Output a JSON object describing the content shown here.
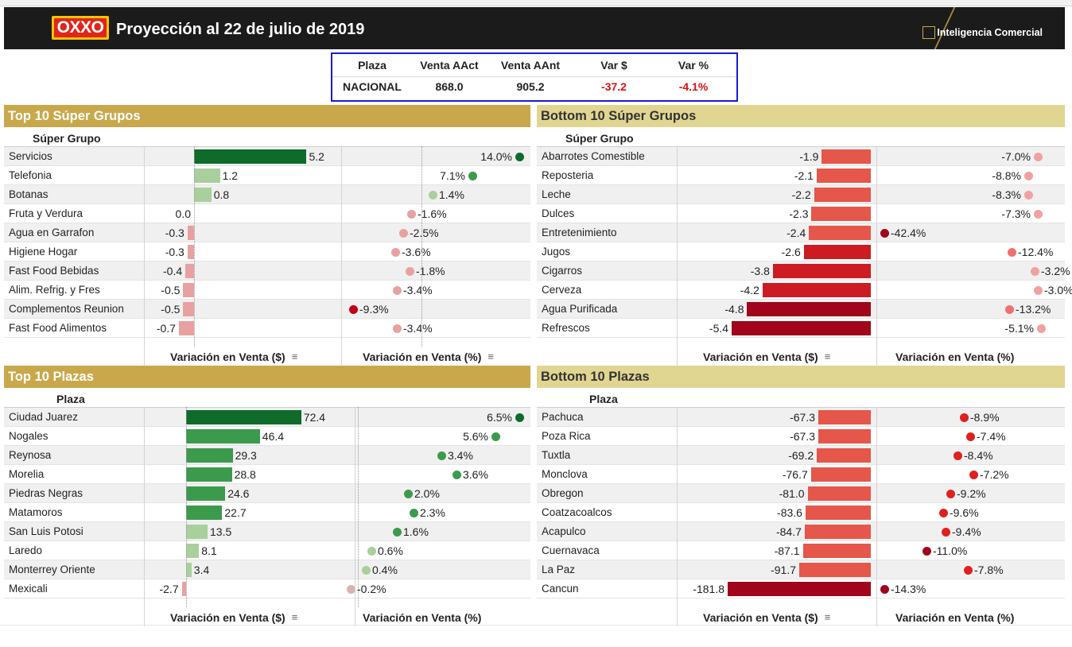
{
  "header": {
    "logo": "OXXO",
    "title": "Proyección al 22 de julio de 2019",
    "brand": "Inteligencia Comercial"
  },
  "kpi": {
    "headers": [
      "Plaza",
      "Venta AAct",
      "Venta AAnt",
      "Var $",
      "Var %"
    ],
    "values": [
      "NACIONAL",
      "868.0",
      "905.2",
      "-37.2",
      "-4.1%"
    ]
  },
  "colors": {
    "dark_green": "#0e6b2a",
    "green": "#3c9a4c",
    "light_green": "#a9cf9c",
    "pale_red": "#e8a1a1",
    "red": "#e4574a",
    "dark_red": "#a0051c"
  },
  "footer_labels": {
    "var_venta_abs": "Variación en Venta ($)",
    "var_venta_pct": "Variación en Venta (%)"
  },
  "panels": {
    "top_super": {
      "title": "Top 10 Súper Grupos",
      "col_header": "Súper Grupo",
      "rows": [
        {
          "name": "Servicios",
          "val": 5.2,
          "label": "5.2",
          "pct": 14.0,
          "pct_label": "14.0%"
        },
        {
          "name": "Telefonia",
          "val": 1.2,
          "label": "1.2",
          "pct": 7.1,
          "pct_label": "7.1%"
        },
        {
          "name": "Botanas",
          "val": 0.8,
          "label": "0.8",
          "pct": 1.4,
          "pct_label": "1.4%"
        },
        {
          "name": "Fruta y Verdura",
          "val": 0.0,
          "label": "0.0",
          "pct": -1.6,
          "pct_label": "-1.6%"
        },
        {
          "name": "Agua en Garrafon",
          "val": -0.3,
          "label": "-0.3",
          "pct": -2.5,
          "pct_label": "-2.5%"
        },
        {
          "name": "Higiene Hogar",
          "val": -0.3,
          "label": "-0.3",
          "pct": -3.6,
          "pct_label": "-3.6%"
        },
        {
          "name": "Fast Food Bebidas",
          "val": -0.4,
          "label": "-0.4",
          "pct": -1.8,
          "pct_label": "-1.8%"
        },
        {
          "name": "Alim. Refrig. y Fres",
          "val": -0.5,
          "label": "-0.5",
          "pct": -3.4,
          "pct_label": "-3.4%"
        },
        {
          "name": "Complementos Reunion",
          "val": -0.5,
          "label": "-0.5",
          "pct": -9.3,
          "pct_label": "-9.3%"
        },
        {
          "name": "Fast Food Alimentos",
          "val": -0.7,
          "label": "-0.7",
          "pct": -3.4,
          "pct_label": "-3.4%"
        }
      ]
    },
    "bottom_super": {
      "title": "Bottom 10 Súper Grupos",
      "col_header": "Súper Grupo",
      "rows": [
        {
          "name": "Abarrotes Comestible",
          "val": -1.9,
          "label": "-1.9",
          "pct": -7.0,
          "pct_label": "-7.0%"
        },
        {
          "name": "Reposteria",
          "val": -2.1,
          "label": "-2.1",
          "pct": -8.8,
          "pct_label": "-8.8%"
        },
        {
          "name": "Leche",
          "val": -2.2,
          "label": "-2.2",
          "pct": -8.3,
          "pct_label": "-8.3%"
        },
        {
          "name": "Dulces",
          "val": -2.3,
          "label": "-2.3",
          "pct": -7.3,
          "pct_label": "-7.3%"
        },
        {
          "name": "Entretenimiento",
          "val": -2.4,
          "label": "-2.4",
          "pct": -42.4,
          "pct_label": "-42.4%"
        },
        {
          "name": "Jugos",
          "val": -2.6,
          "label": "-2.6",
          "pct": -12.4,
          "pct_label": "-12.4%"
        },
        {
          "name": "Cigarros",
          "val": -3.8,
          "label": "-3.8",
          "pct": -3.2,
          "pct_label": "-3.2%"
        },
        {
          "name": "Cerveza",
          "val": -4.2,
          "label": "-4.2",
          "pct": -3.0,
          "pct_label": "-3.0%"
        },
        {
          "name": "Agua Purificada",
          "val": -4.8,
          "label": "-4.8",
          "pct": -13.2,
          "pct_label": "-13.2%"
        },
        {
          "name": "Refrescos",
          "val": -5.4,
          "label": "-5.4",
          "pct": -5.1,
          "pct_label": "-5.1%"
        }
      ]
    },
    "top_plazas": {
      "title": "Top 10 Plazas",
      "col_header": "Plaza",
      "rows": [
        {
          "name": "Ciudad Juarez",
          "val": 72.4,
          "label": "72.4",
          "pct": 6.5,
          "pct_label": "6.5%"
        },
        {
          "name": "Nogales",
          "val": 46.4,
          "label": "46.4",
          "pct": 5.6,
          "pct_label": "5.6%"
        },
        {
          "name": "Reynosa",
          "val": 29.3,
          "label": "29.3",
          "pct": 3.4,
          "pct_label": "3.4%"
        },
        {
          "name": "Morelia",
          "val": 28.8,
          "label": "28.8",
          "pct": 3.6,
          "pct_label": "3.6%"
        },
        {
          "name": "Piedras Negras",
          "val": 24.6,
          "label": "24.6",
          "pct": 2.0,
          "pct_label": "2.0%"
        },
        {
          "name": "Matamoros",
          "val": 22.7,
          "label": "22.7",
          "pct": 2.3,
          "pct_label": "2.3%"
        },
        {
          "name": "San Luis Potosi",
          "val": 13.5,
          "label": "13.5",
          "pct": 1.6,
          "pct_label": "1.6%"
        },
        {
          "name": "Laredo",
          "val": 8.1,
          "label": "8.1",
          "pct": 0.6,
          "pct_label": "0.6%"
        },
        {
          "name": "Monterrey Oriente",
          "val": 3.4,
          "label": "3.4",
          "pct": 0.4,
          "pct_label": "0.4%"
        },
        {
          "name": "Mexicali",
          "val": -2.7,
          "label": "-2.7",
          "pct": -0.2,
          "pct_label": "-0.2%"
        }
      ]
    },
    "bottom_plazas": {
      "title": "Bottom 10 Plazas",
      "col_header": "Plaza",
      "rows": [
        {
          "name": "Pachuca",
          "val": -67.3,
          "label": "-67.3",
          "pct": -8.9,
          "pct_label": "-8.9%"
        },
        {
          "name": "Poza Rica",
          "val": -67.3,
          "label": "-67.3",
          "pct": -7.4,
          "pct_label": "-7.4%"
        },
        {
          "name": "Tuxtla",
          "val": -69.2,
          "label": "-69.2",
          "pct": -8.4,
          "pct_label": "-8.4%"
        },
        {
          "name": "Monclova",
          "val": -76.7,
          "label": "-76.7",
          "pct": -7.2,
          "pct_label": "-7.2%"
        },
        {
          "name": "Obregon",
          "val": -81.0,
          "label": "-81.0",
          "pct": -9.2,
          "pct_label": "-9.2%"
        },
        {
          "name": "Coatzacoalcos",
          "val": -83.6,
          "label": "-83.6",
          "pct": -9.6,
          "pct_label": "-9.6%"
        },
        {
          "name": "Acapulco",
          "val": -84.7,
          "label": "-84.7",
          "pct": -9.4,
          "pct_label": "-9.4%"
        },
        {
          "name": "Cuernavaca",
          "val": -87.1,
          "label": "-87.1",
          "pct": -11.0,
          "pct_label": "-11.0%"
        },
        {
          "name": "La Paz",
          "val": -91.7,
          "label": "-91.7",
          "pct": -7.8,
          "pct_label": "-7.8%"
        },
        {
          "name": "Cancun",
          "val": -181.8,
          "label": "-181.8",
          "pct": -14.3,
          "pct_label": "-14.3%"
        }
      ]
    }
  }
}
